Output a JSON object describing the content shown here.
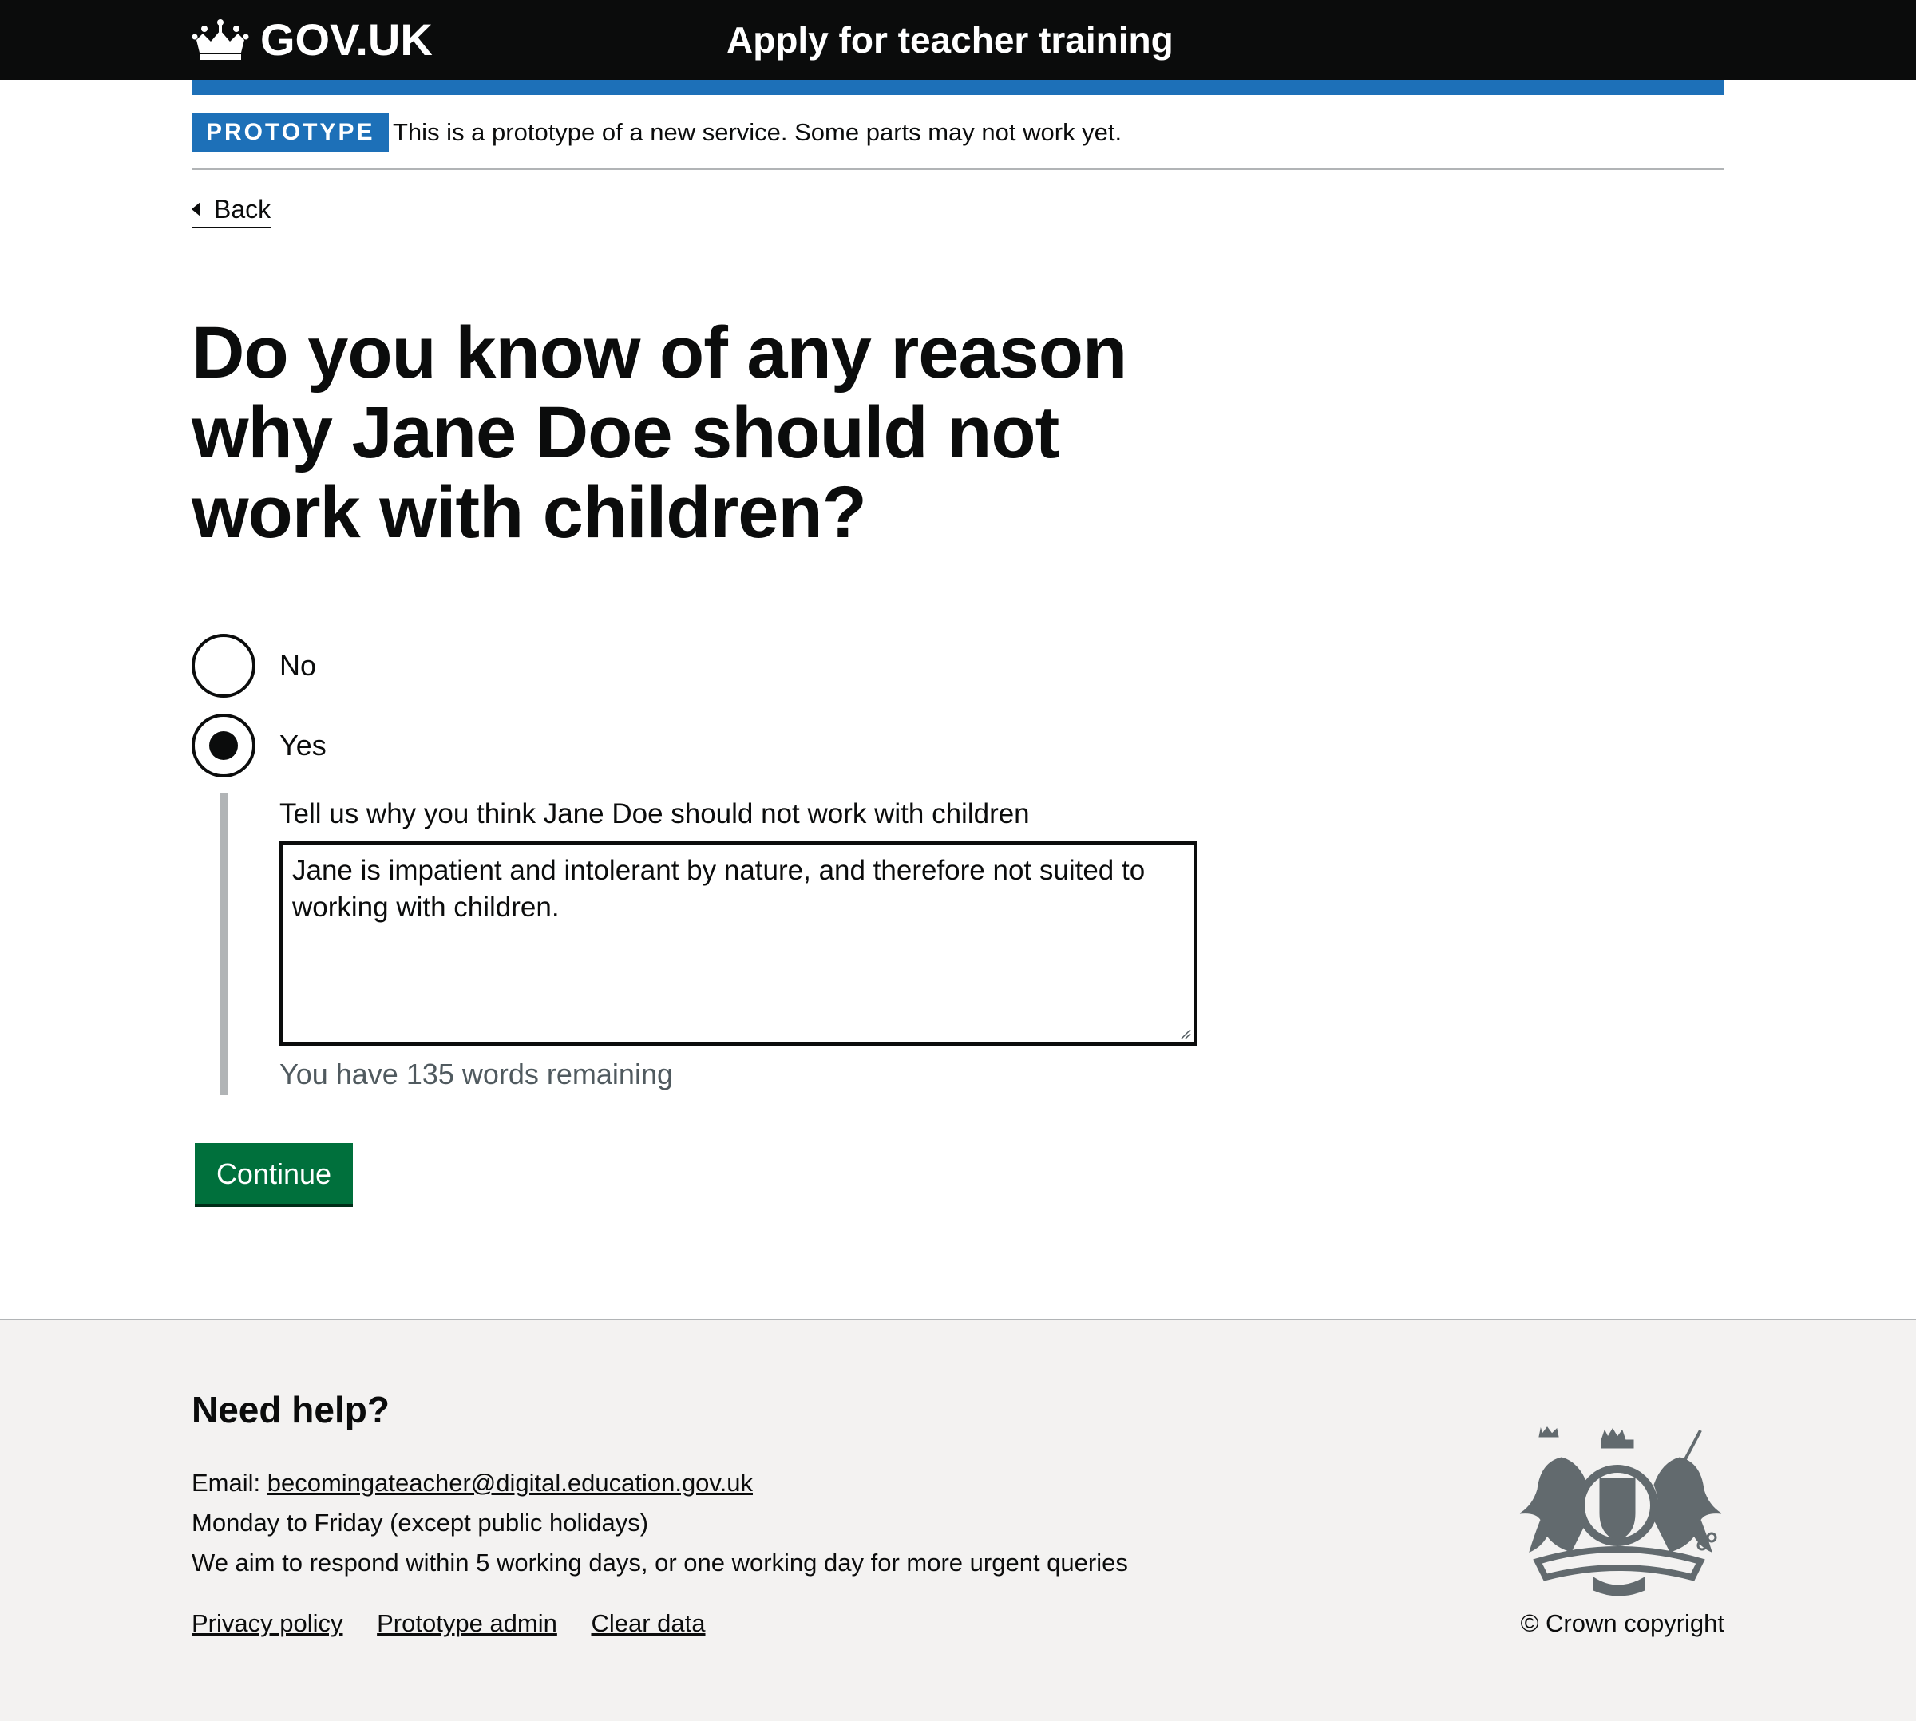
{
  "header": {
    "logo_text": "GOV.UK",
    "service_name": "Apply for teacher training"
  },
  "phase_banner": {
    "tag": "PROTOTYPE",
    "text": "This is a prototype of a new service. Some parts may not work yet."
  },
  "back_link": "Back",
  "question": {
    "heading": "Do you know of any reason why Jane Doe should not work with children?",
    "options": [
      {
        "label": "No",
        "checked": false
      },
      {
        "label": "Yes",
        "checked": true
      }
    ],
    "conditional_label": "Tell us why you think Jane Doe should not work with children",
    "textarea_value": "Jane is impatient and intolerant by nature, and therefore not suited to working with children.",
    "hint": "You have 135 words remaining"
  },
  "continue_label": "Continue",
  "footer": {
    "heading": "Need help?",
    "email_prefix": "Email: ",
    "email": "becomingateacher@digital.education.gov.uk",
    "hours": "Monday to Friday (except public holidays)",
    "response": "We aim to respond within 5 working days, or one working day for more urgent queries",
    "links": [
      "Privacy policy",
      "Prototype admin",
      "Clear data"
    ],
    "copyright": "© Crown copyright"
  },
  "colors": {
    "header_bg": "#0b0c0c",
    "brand_blue": "#1d70b8",
    "button_green": "#00703c",
    "footer_bg": "#f3f2f1",
    "hint_grey": "#505a5f"
  }
}
